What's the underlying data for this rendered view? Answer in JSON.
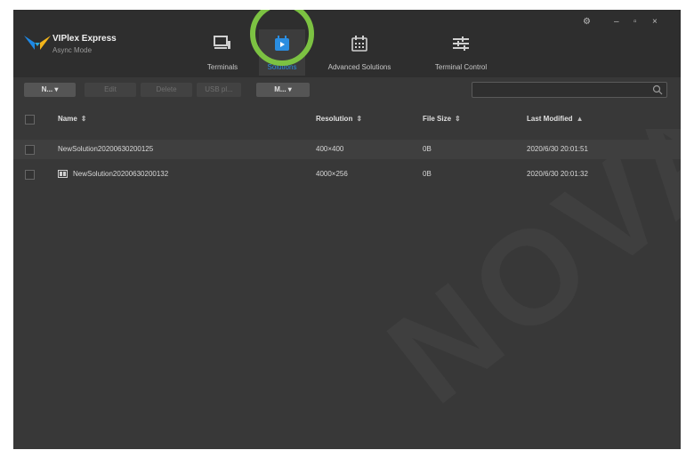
{
  "app": {
    "name": "VIPlex Express",
    "mode": "Async Mode"
  },
  "nav": {
    "tabs": [
      {
        "label": "Terminals",
        "icon": "terminal-icon",
        "active": false
      },
      {
        "label": "Solutions",
        "icon": "play-icon",
        "active": true
      },
      {
        "label": "Advanced Solutions",
        "icon": "calendar-icon",
        "active": false
      },
      {
        "label": "Terminal Control",
        "icon": "sliders-icon",
        "active": false
      }
    ]
  },
  "window_controls": {
    "settings": "⚙",
    "minimize": "–",
    "maximize": "▫",
    "close": "×"
  },
  "toolbar": {
    "new_label": "N... ▾",
    "edit_label": "Edit",
    "delete_label": "Delete",
    "usb_label": "USB pl...",
    "more_label": "M... ▾",
    "search_placeholder": ""
  },
  "table": {
    "columns": [
      {
        "label": "Name",
        "sort": "⇕"
      },
      {
        "label": "Resolution",
        "sort": "⇕"
      },
      {
        "label": "File Size",
        "sort": "⇕"
      },
      {
        "label": "Last Modified",
        "sort": "▲"
      }
    ],
    "rows": [
      {
        "name": "NewSolution20200630200125",
        "resolution": "400×400",
        "size": "0B",
        "modified": "2020/6/30 20:01:51",
        "icon": false
      },
      {
        "name": "NewSolution20200630200132",
        "resolution": "4000×256",
        "size": "0B",
        "modified": "2020/6/30 20:01:32",
        "icon": true
      }
    ]
  },
  "watermark": "NOVASTAR",
  "colors": {
    "accent": "#2a8de0",
    "highlight_ring": "#7cc242",
    "background": "#383838",
    "titlebar": "#2e2e2e"
  }
}
